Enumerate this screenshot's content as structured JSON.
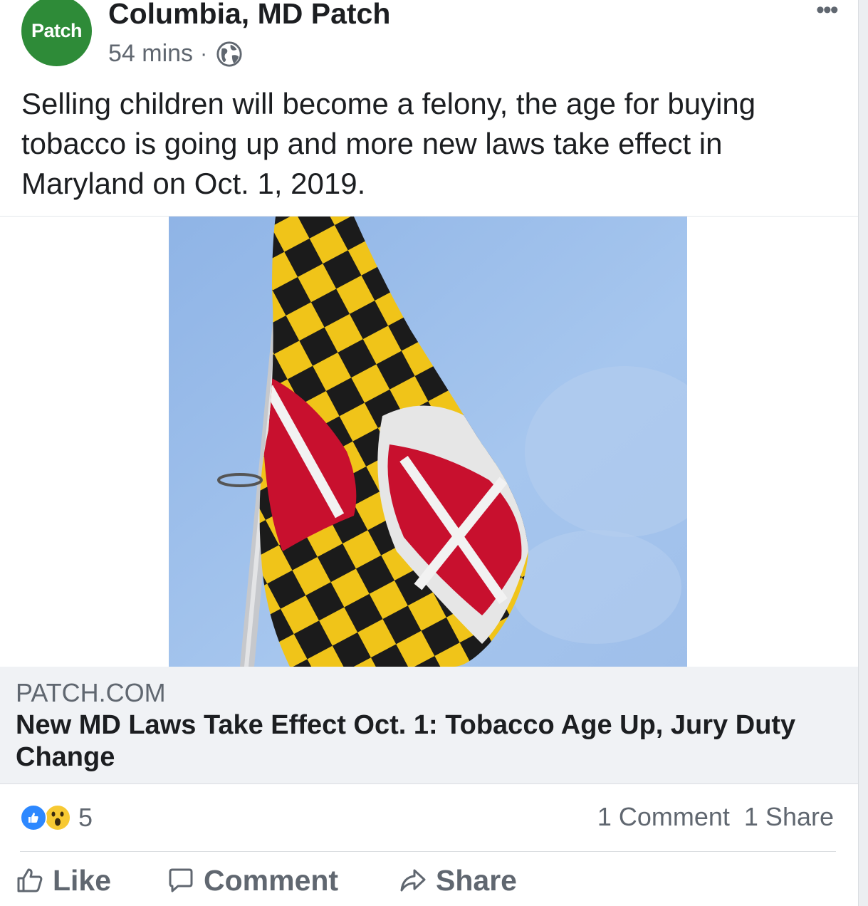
{
  "post": {
    "page_name": "Columbia, MD Patch",
    "avatar_text": "Patch",
    "avatar_color": "#2e8b38",
    "time": "54 mins",
    "separator": "·",
    "privacy_icon": "globe-icon",
    "more_label": "•••",
    "text": "Selling children will become a felony, the age for buying tobacco is going up and more new laws take effect in Maryland on Oct. 1, 2019."
  },
  "link_preview": {
    "domain": "PATCH.COM",
    "title": "New MD Laws Take Effect Oct. 1: Tobacco Age Up, Jury Duty Change",
    "image_subject": "maryland-flag-photo"
  },
  "engagement": {
    "reaction_icons": [
      "like-reaction-icon",
      "wow-reaction-icon"
    ],
    "reaction_count": "5",
    "comments": "1 Comment",
    "shares": "1 Share"
  },
  "actions": {
    "like": "Like",
    "comment": "Comment",
    "share": "Share"
  },
  "colors": {
    "link_box_bg": "#f0f2f5",
    "secondary_text": "#606770",
    "like_blue": "#2d88ff",
    "wow_yellow": "#f7c933"
  }
}
